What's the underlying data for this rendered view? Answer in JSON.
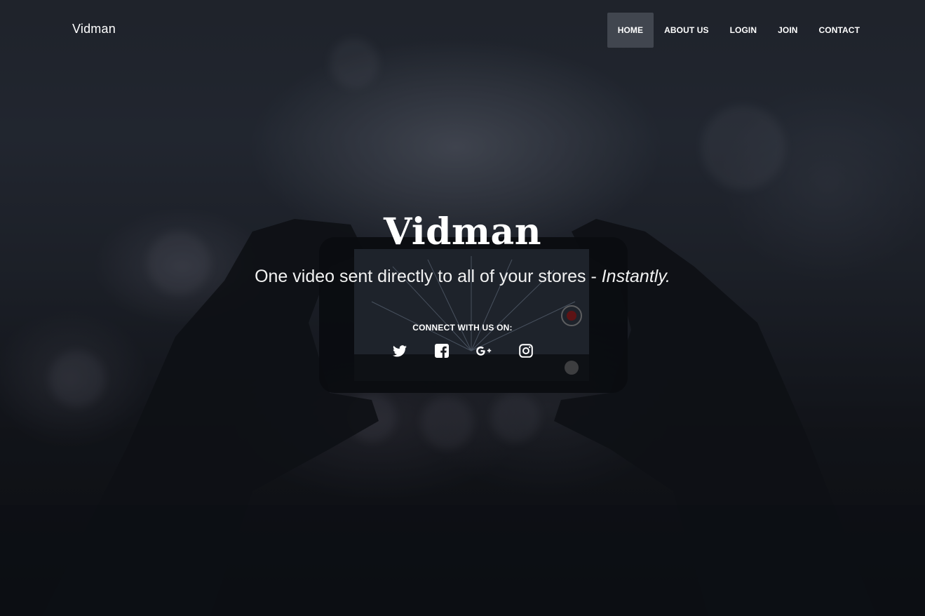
{
  "navbar": {
    "brand": "Vidman",
    "items": [
      {
        "label": "HOME",
        "active": true
      },
      {
        "label": "ABOUT US",
        "active": false
      },
      {
        "label": "LOGIN",
        "active": false
      },
      {
        "label": "JOIN",
        "active": false
      },
      {
        "label": "CONTACT",
        "active": false
      }
    ]
  },
  "hero": {
    "title": "Vidman",
    "tagline": "One video sent directly to all of your stores - ",
    "tagline_emphasis": "Instantly.",
    "connect_label": "CONNECT WITH US ON:",
    "social_icons": [
      "twitter-icon",
      "facebook-icon",
      "google-plus-icon",
      "instagram-icon"
    ]
  },
  "colors": {
    "text": "#ffffff",
    "nav_active_bg": "#484c56",
    "background": "#15171c"
  }
}
